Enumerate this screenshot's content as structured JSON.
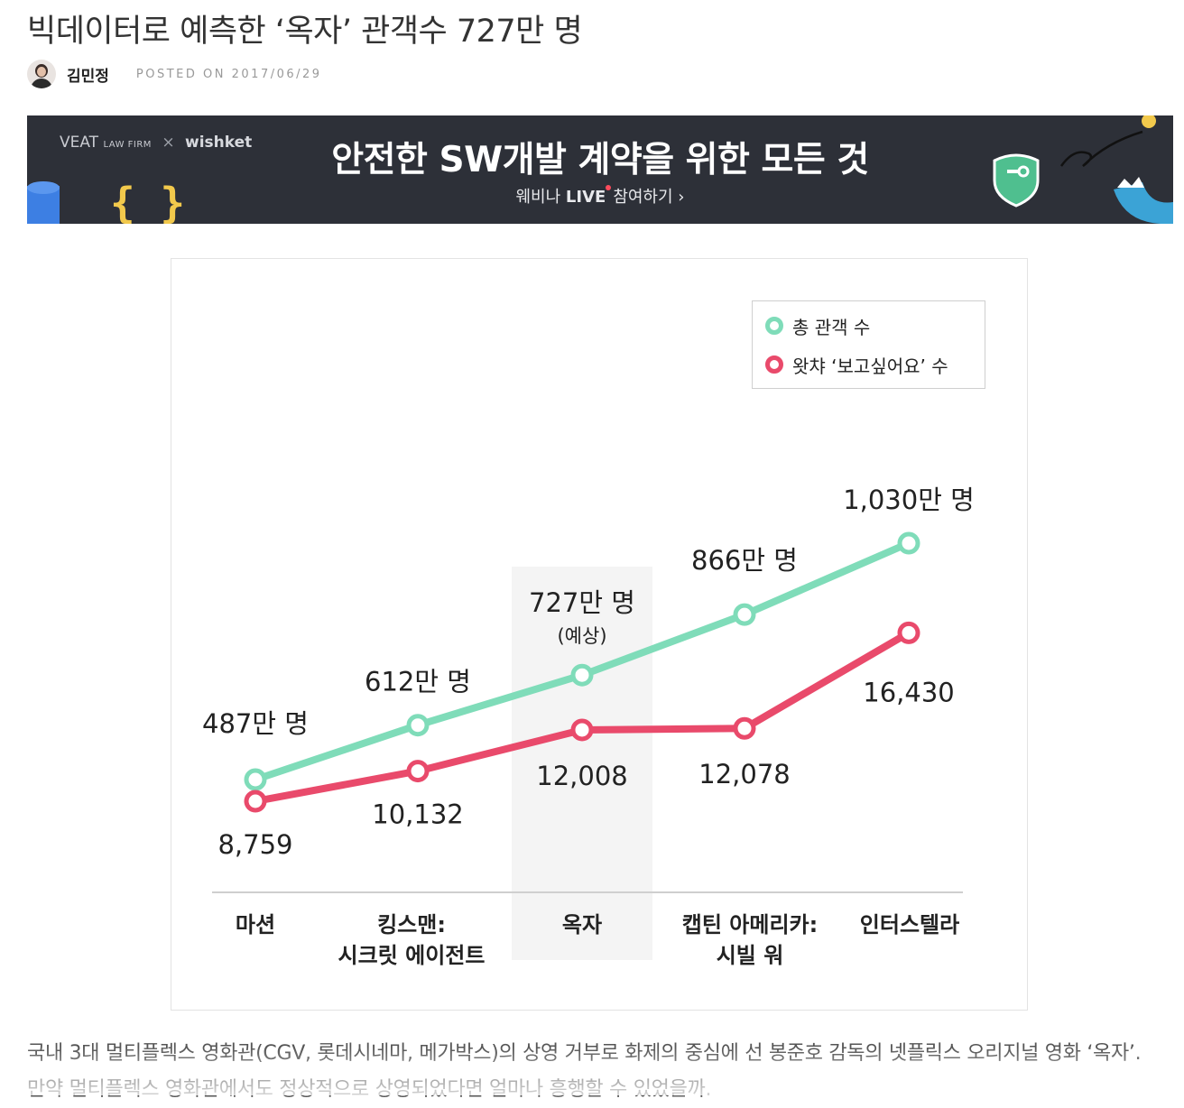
{
  "article": {
    "title": "빅데이터로 예측한 ‘옥자’ 관객수 727만 명",
    "author": "김민정",
    "posted": "POSTED ON 2017/06/29",
    "body": "국내 3대 멀티플렉스 영화관(CGV, 롯데시네마, 메가박스)의 상영 거부로 화제의 중심에 선 봉준호 감독의 넷플릭스 오리지널 영화 ‘옥자’. 만약 멀티플렉스 영화관에서도 정상적으로 상영되었다면 얼마나 흥행할 수 있었을까."
  },
  "banner": {
    "brand_main": "VEAT",
    "brand_sub": "LAW FIRM",
    "brand_sep": "×",
    "brand_partner": "wishket",
    "headline": "안전한 SW개발 계약을 위한 모든 것",
    "cta_pre": "웨비나 ",
    "cta_live": "LIVE",
    "cta_post": "참여하기 ›",
    "bg_color": "#2d3038"
  },
  "chart_data": {
    "type": "line",
    "categories": [
      [
        "마션"
      ],
      [
        "킹스맨:",
        "시크릿 에이전트"
      ],
      [
        "옥자"
      ],
      [
        "캡틴 아메리카:",
        "시빌 워"
      ],
      [
        "인터스텔라"
      ]
    ],
    "highlight_index": 2,
    "series": [
      {
        "name": "총 관객 수",
        "unit": "만 명",
        "color": "#7fdcb9",
        "values": [
          487,
          612,
          727,
          866,
          1030
        ],
        "labels": [
          "487만 명",
          "612만 명",
          "727만 명",
          "866만 명",
          "1,030만 명"
        ],
        "label_notes": [
          "",
          "",
          "(예상)",
          "",
          ""
        ]
      },
      {
        "name": "왓챠 ‘보고싶어요’ 수",
        "color": "#e94a6b",
        "values": [
          8759,
          10132,
          12008,
          12078,
          16430
        ],
        "labels": [
          "8,759",
          "10,132",
          "12,008",
          "12,078",
          "16,430"
        ]
      }
    ],
    "legend_position": "top-right",
    "grid": false
  }
}
